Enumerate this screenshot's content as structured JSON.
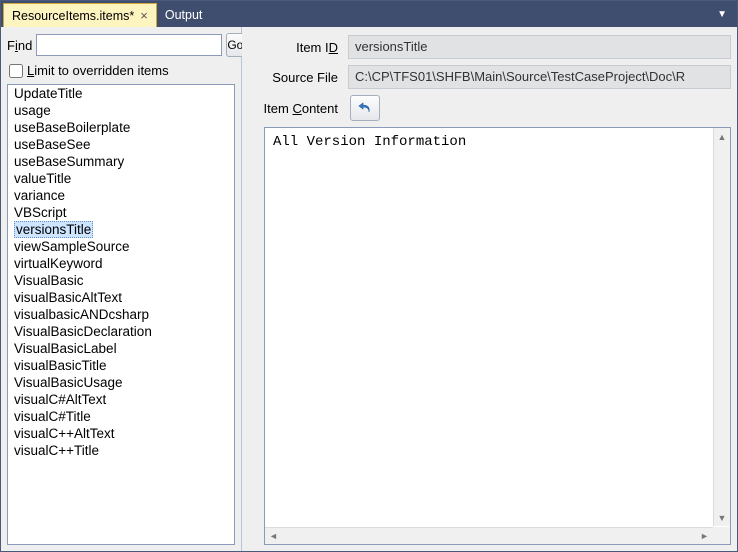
{
  "tabs": [
    {
      "label": "ResourceItems.items*",
      "active": true,
      "closeable": true
    },
    {
      "label": "Output",
      "active": false,
      "closeable": false
    }
  ],
  "find": {
    "label_pre": "F",
    "label_mn": "i",
    "label_post": "nd",
    "value": "",
    "go_label": "Go"
  },
  "limit": {
    "checked": false,
    "label_mn": "L",
    "label_rest": "imit to overridden items"
  },
  "items": [
    "UpdateTitle",
    "usage",
    "useBaseBoilerplate",
    "useBaseSee",
    "useBaseSummary",
    "valueTitle",
    "variance",
    "VBScript",
    "versionsTitle",
    "viewSampleSource",
    "virtualKeyword",
    "VisualBasic",
    "visualBasicAltText",
    "visualbasicANDcsharp",
    "VisualBasicDeclaration",
    "VisualBasicLabel",
    "visualBasicTitle",
    "VisualBasicUsage",
    "visualC#AltText",
    "visualC#Title",
    "visualC++AltText",
    "visualC++Title"
  ],
  "selected_index": 8,
  "detail": {
    "item_id_label_pre": "Item I",
    "item_id_label_mn": "D",
    "item_id_value": "versionsTitle",
    "source_file_label": "Source File",
    "source_file_value": "C:\\CP\\TFS01\\SHFB\\Main\\Source\\TestCaseProject\\Doc\\R",
    "item_content_label_pre": "Item ",
    "item_content_label_mn": "C",
    "item_content_label_post": "ontent",
    "content_value": "All Version Information"
  }
}
